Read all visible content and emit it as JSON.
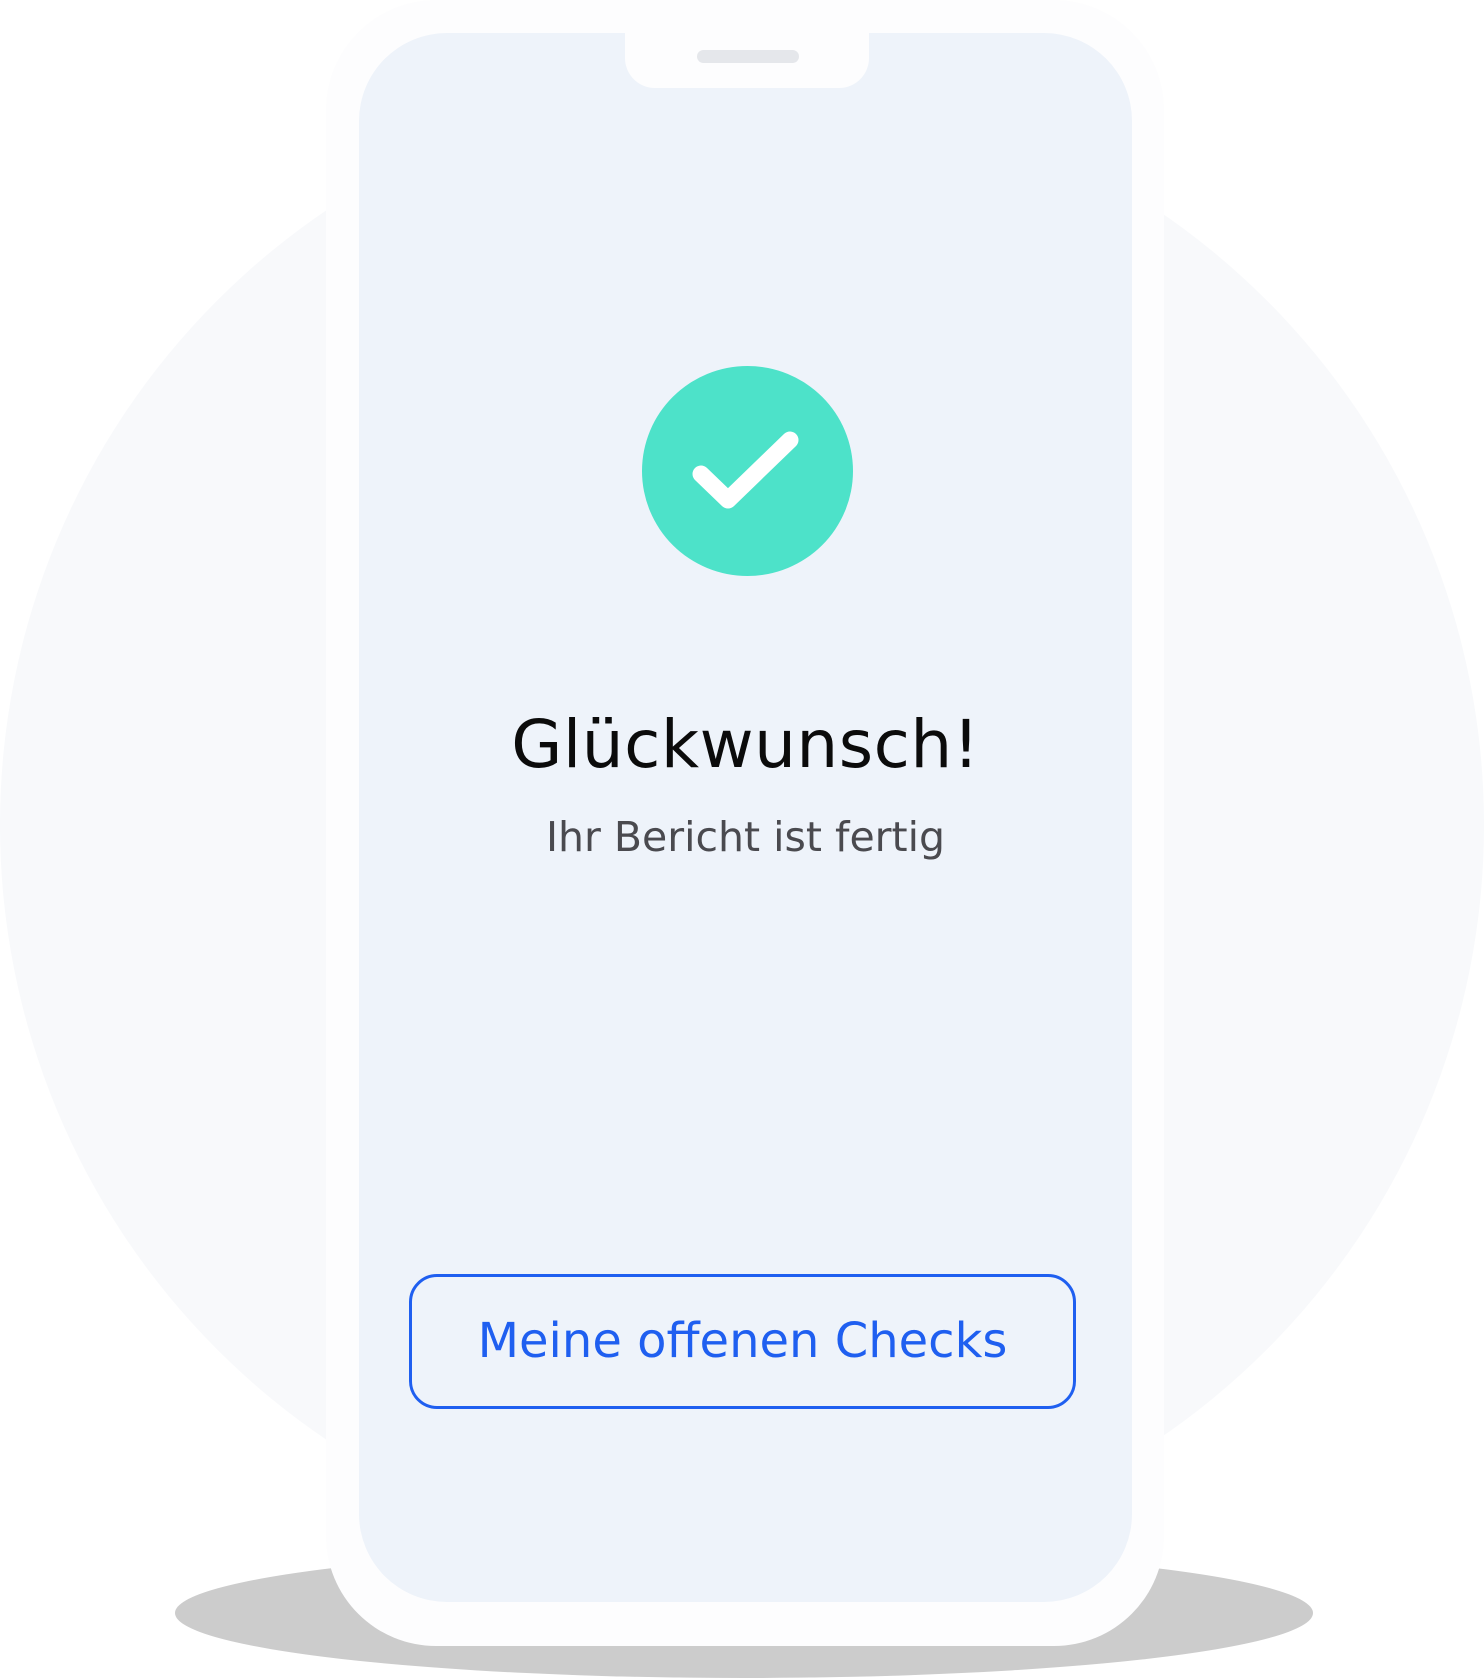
{
  "success": {
    "icon": "checkmark-circle-icon",
    "color": "#4de2c9",
    "title": "Glückwunsch!",
    "subtitle": "Ihr Bericht ist fertig"
  },
  "actions": {
    "open_checks_label": "Meine offenen Checks",
    "accent_color": "#1f5ff0"
  }
}
